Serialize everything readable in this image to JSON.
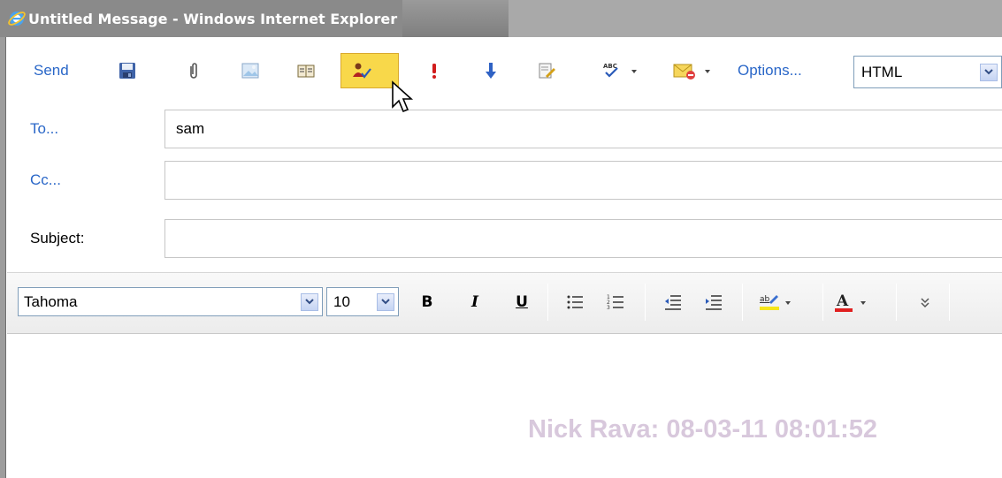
{
  "window": {
    "title": "Untitled Message - Windows Internet Explorer"
  },
  "toolbar": {
    "send_label": "Send",
    "options_label": "Options...",
    "format_value": "HTML",
    "icons": [
      "save-icon",
      "attach-icon",
      "insert-image-icon",
      "address-book-icon",
      "check-names-icon",
      "high-importance-icon",
      "low-importance-icon",
      "signature-icon",
      "spelling-icon",
      "read-receipt-icon"
    ]
  },
  "header": {
    "to_label": "To...",
    "to_value": "sam",
    "cc_label": "Cc...",
    "cc_value": "",
    "subject_label": "Subject:",
    "subject_value": ""
  },
  "format": {
    "font_value": "Tahoma",
    "size_value": "10",
    "bold": "B",
    "italic": "I",
    "underline": "U",
    "highlight_color": "#f5e51a",
    "font_color": "#e02020"
  },
  "body": {
    "watermark": "Nick Rava: 08-03-11 08:01:52"
  }
}
